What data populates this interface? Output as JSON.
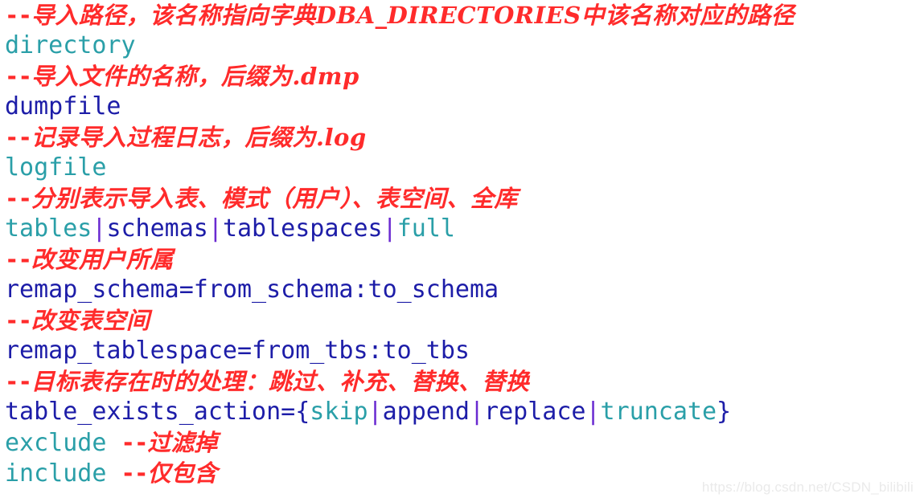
{
  "document": {
    "kind": "code-snippet",
    "background_color": "#ffffff",
    "comment_color": "#ff2b2b",
    "code_color_primary": "#1d1da8",
    "code_color_secondary": "#2a9fa8",
    "code_color_accent": "#6a2ad1"
  },
  "lines": [
    {
      "type": "comment",
      "dashes": "--",
      "text": "导入路径，该名称指向字典DBA_DIRECTORIES中该名称对应的路径"
    },
    {
      "type": "code",
      "tokens": [
        {
          "text": "directory",
          "color": "teal"
        }
      ]
    },
    {
      "type": "comment",
      "dashes": "--",
      "text": "导入文件的名称，后缀为.dmp"
    },
    {
      "type": "code",
      "tokens": [
        {
          "text": "dumpfile",
          "color": "blue"
        }
      ]
    },
    {
      "type": "comment",
      "dashes": "--",
      "text": "记录导入过程日志，后缀为.log"
    },
    {
      "type": "code",
      "tokens": [
        {
          "text": "logfile",
          "color": "teal"
        }
      ]
    },
    {
      "type": "comment",
      "dashes": "--",
      "text": "分别表示导入表、模式（用户）、表空间、全库"
    },
    {
      "type": "code",
      "tokens": [
        {
          "text": "tables",
          "color": "teal"
        },
        {
          "text": "|",
          "color": "purple"
        },
        {
          "text": "schemas",
          "color": "blue"
        },
        {
          "text": "|",
          "color": "purple"
        },
        {
          "text": "tablespaces",
          "color": "blue"
        },
        {
          "text": "|",
          "color": "purple"
        },
        {
          "text": "full",
          "color": "teal"
        }
      ]
    },
    {
      "type": "comment",
      "dashes": "--",
      "text": "改变用户所属"
    },
    {
      "type": "code",
      "tokens": [
        {
          "text": "remap_schema=from_schema:to_schema",
          "color": "blue"
        }
      ]
    },
    {
      "type": "comment",
      "dashes": "--",
      "text": "改变表空间"
    },
    {
      "type": "code",
      "tokens": [
        {
          "text": "remap_tablespace=from_tbs:to_tbs",
          "color": "blue"
        }
      ]
    },
    {
      "type": "comment",
      "dashes": "--",
      "text": "目标表存在时的处理：跳过、补充、替换、替换"
    },
    {
      "type": "code",
      "tokens": [
        {
          "text": "table_exists_action={",
          "color": "blue"
        },
        {
          "text": "skip",
          "color": "teal"
        },
        {
          "text": "|",
          "color": "purple"
        },
        {
          "text": "append",
          "color": "blue"
        },
        {
          "text": "|",
          "color": "purple"
        },
        {
          "text": "replace",
          "color": "blue"
        },
        {
          "text": "|",
          "color": "purple"
        },
        {
          "text": "truncate",
          "color": "teal"
        },
        {
          "text": "}",
          "color": "blue"
        }
      ]
    },
    {
      "type": "code-with-comment",
      "tokens": [
        {
          "text": "exclude ",
          "color": "teal"
        }
      ],
      "dashes": "--",
      "comment": "过滤掉"
    },
    {
      "type": "code-with-comment",
      "tokens": [
        {
          "text": "include ",
          "color": "teal"
        }
      ],
      "dashes": "--",
      "comment": "仅包含"
    }
  ],
  "watermark": {
    "text": "https://blog.csdn.net/CSDN_bilibili"
  }
}
